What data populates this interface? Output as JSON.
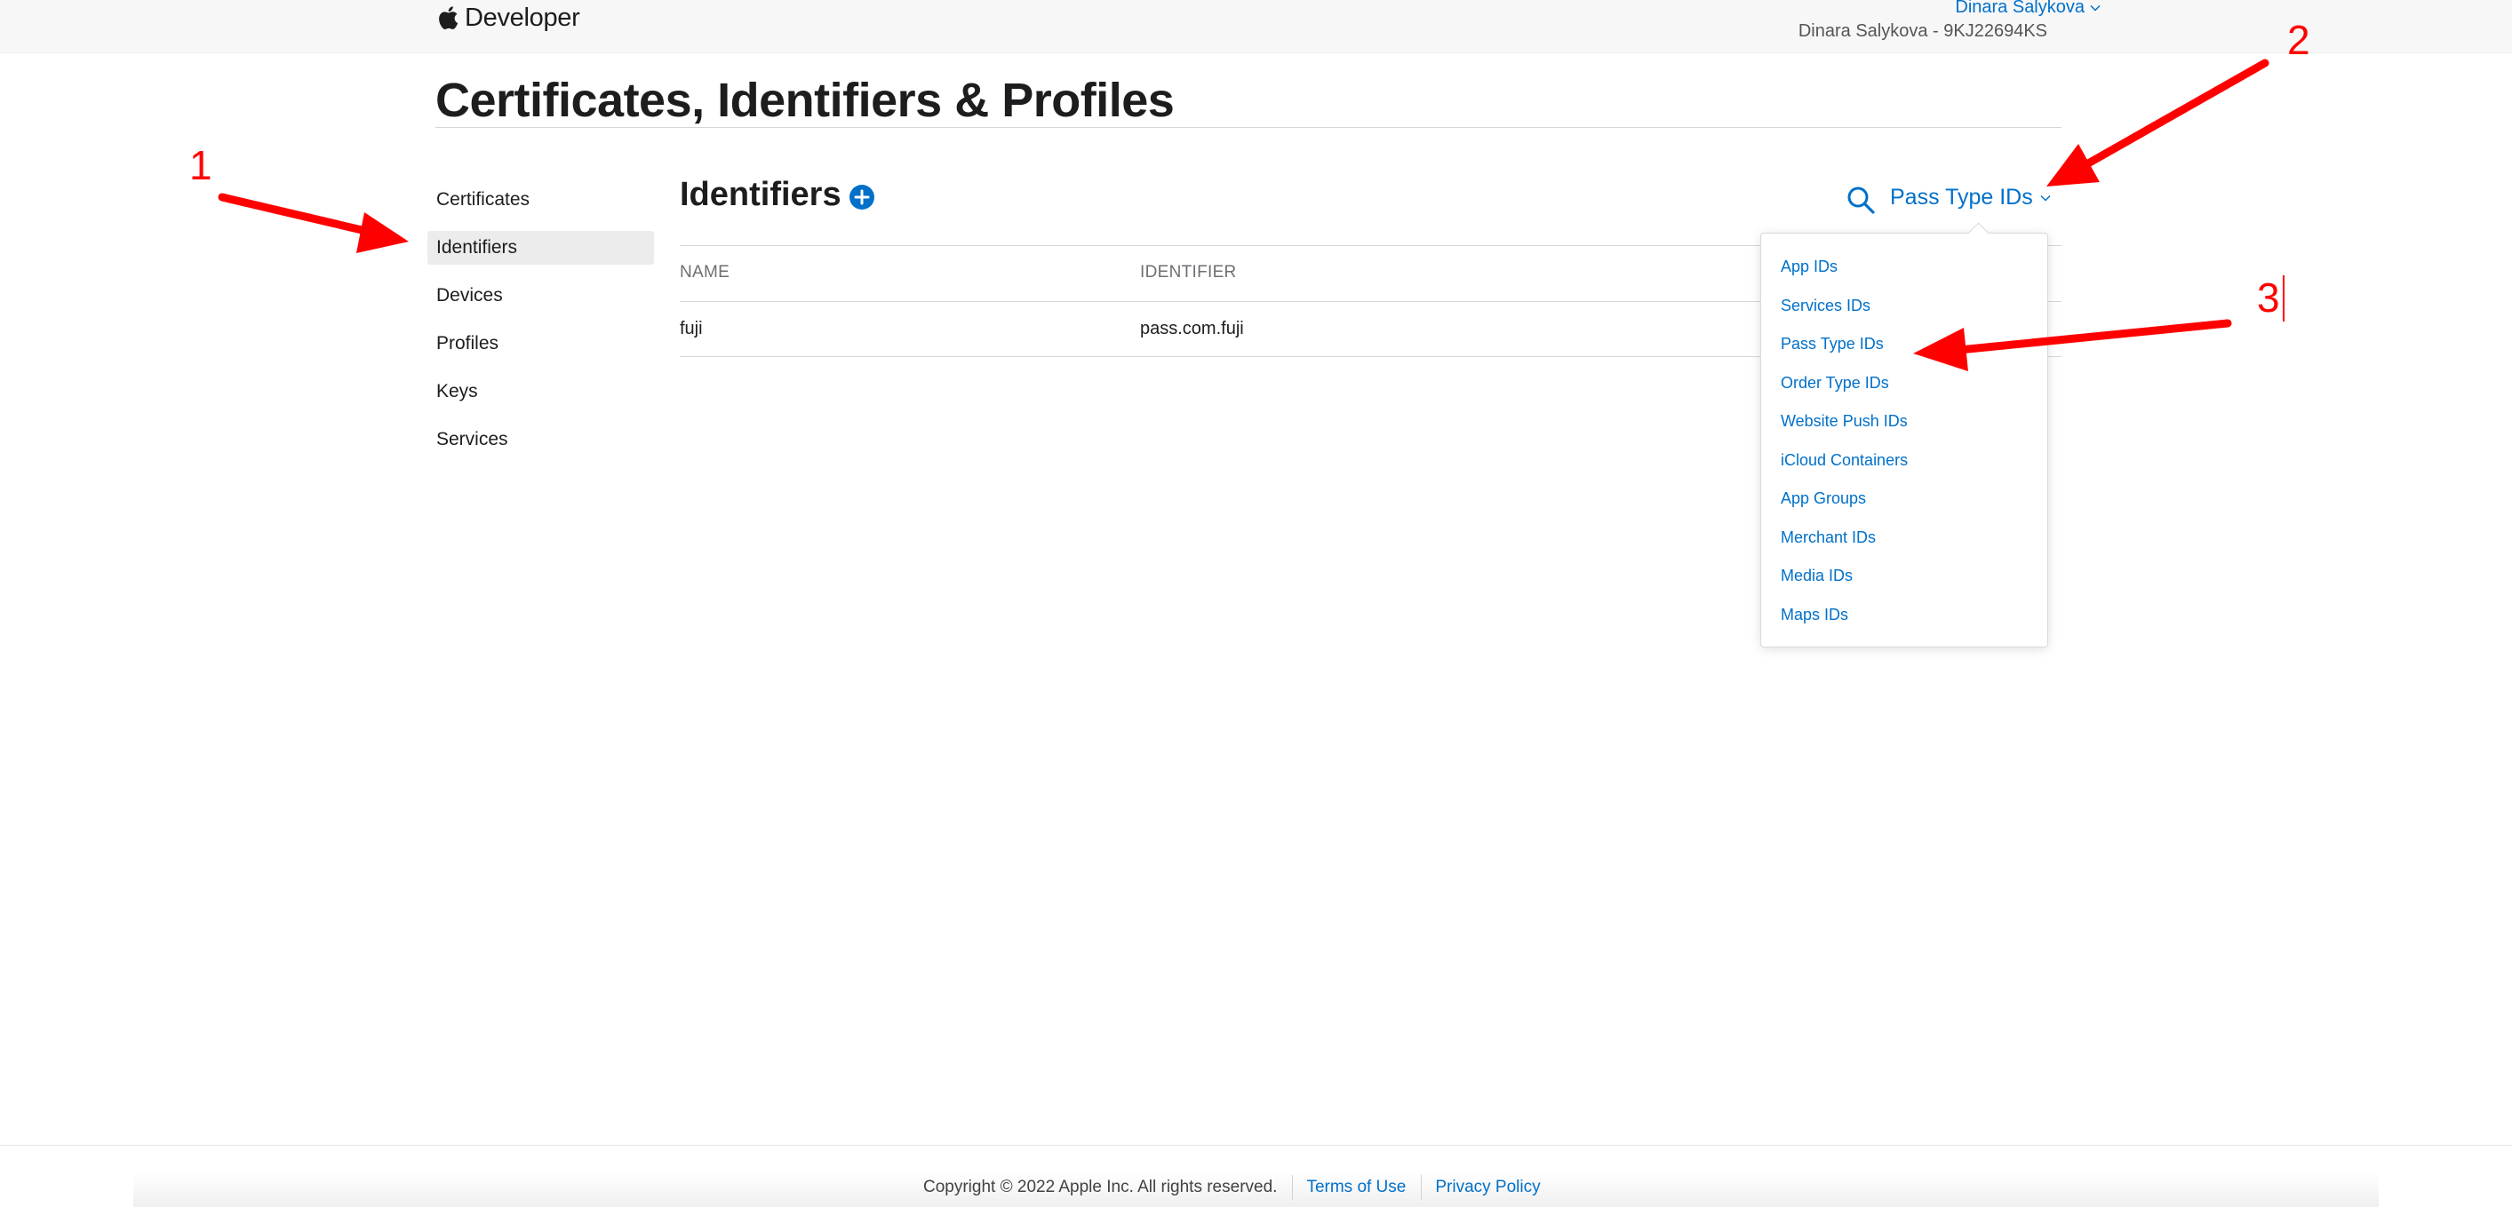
{
  "header": {
    "brand": "Developer",
    "account_name": "Dinara Salykova",
    "team": "Dinara Salykova - 9KJ22694KS"
  },
  "page_title": "Certificates, Identifiers & Profiles",
  "sidebar": {
    "items": [
      {
        "label": "Certificates"
      },
      {
        "label": "Identifiers",
        "active": true
      },
      {
        "label": "Devices"
      },
      {
        "label": "Profiles"
      },
      {
        "label": "Keys"
      },
      {
        "label": "Services"
      }
    ]
  },
  "section": {
    "title": "Identifiers",
    "filter_label": "Pass Type IDs"
  },
  "table": {
    "columns": [
      "NAME",
      "IDENTIFIER"
    ],
    "rows": [
      {
        "name": "fuji",
        "identifier": "pass.com.fuji"
      }
    ]
  },
  "dropdown": {
    "options": [
      "App IDs",
      "Services IDs",
      "Pass Type IDs",
      "Order Type IDs",
      "Website Push IDs",
      "iCloud Containers",
      "App Groups",
      "Merchant IDs",
      "Media IDs",
      "Maps IDs"
    ]
  },
  "annotations": {
    "labels": [
      "1",
      "2",
      "3"
    ],
    "color": "#ff0000"
  },
  "footer": {
    "copyright": "Copyright © 2022 Apple Inc. All rights reserved.",
    "terms": "Terms of Use",
    "privacy": "Privacy Policy"
  },
  "colors": {
    "link": "#0070c9",
    "text": "#1d1d1f",
    "active_bg": "#ececec"
  },
  "icons": {
    "logo": "apple-logo-icon",
    "add": "plus-circle-icon",
    "search": "search-icon",
    "dropdown": "chevron-down-icon"
  }
}
